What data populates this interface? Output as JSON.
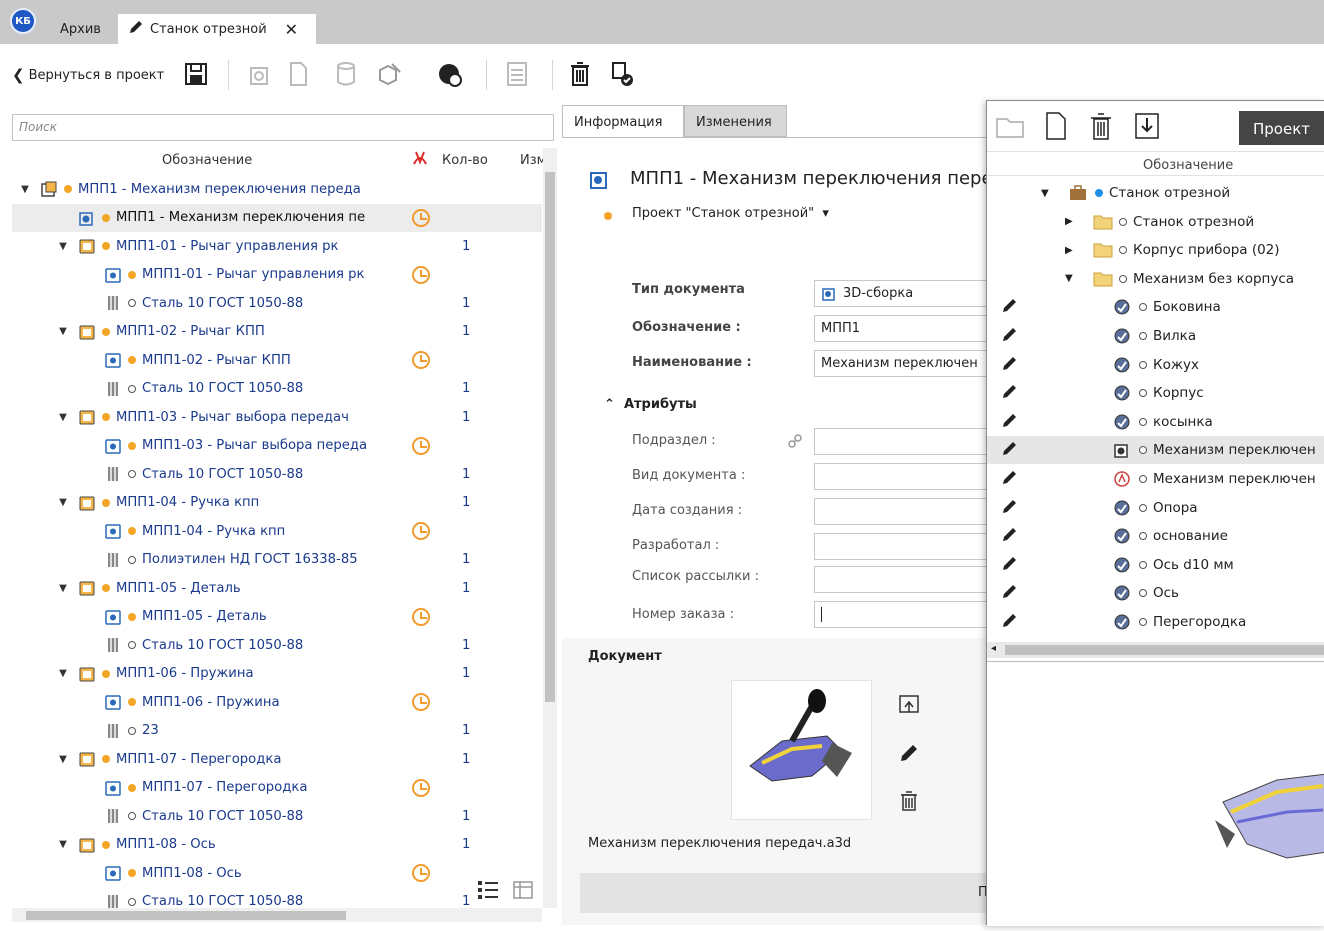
{
  "tabs": {
    "logo": "КБ",
    "archive": "Архив",
    "active": "Станок отрезной",
    "close": "✕"
  },
  "toolbar": {
    "back": "Вернуться в проект"
  },
  "left": {
    "search_placeholder": "Поиск",
    "columns": {
      "designation": "Обозначение",
      "qty": "Кол-во",
      "changes": "Изм"
    },
    "rows": [
      {
        "label": "МПП1 - Механизм переключения переда",
        "qty": "",
        "level": 0,
        "icon": "assembly",
        "dot": "orange",
        "expanded": true,
        "clock": false,
        "sel": false
      },
      {
        "label": "МПП1 - Механизм переключения пе",
        "qty": "",
        "level": 1,
        "icon": "assembly-doc",
        "dot": "orange",
        "expanded": null,
        "clock": true,
        "sel": true
      },
      {
        "label": "МПП1-01 - Рычаг управления рк",
        "qty": "1",
        "level": 1,
        "icon": "part",
        "dot": "orange",
        "expanded": true,
        "clock": false,
        "sel": false
      },
      {
        "label": "МПП1-01 - Рычаг управления рк",
        "qty": "",
        "level": 2,
        "icon": "part-doc",
        "dot": "orange",
        "expanded": null,
        "clock": true,
        "sel": false
      },
      {
        "label": "Сталь 10 ГОСТ 1050-88",
        "qty": "1",
        "level": 2,
        "icon": "material",
        "dot": "hollow",
        "expanded": null,
        "clock": false,
        "sel": false
      },
      {
        "label": "МПП1-02 - Рычаг КПП",
        "qty": "1",
        "level": 1,
        "icon": "part",
        "dot": "orange",
        "expanded": true,
        "clock": false,
        "sel": false
      },
      {
        "label": "МПП1-02 - Рычаг КПП",
        "qty": "",
        "level": 2,
        "icon": "part-doc",
        "dot": "orange",
        "expanded": null,
        "clock": true,
        "sel": false
      },
      {
        "label": "Сталь 10 ГОСТ 1050-88",
        "qty": "1",
        "level": 2,
        "icon": "material",
        "dot": "hollow",
        "expanded": null,
        "clock": false,
        "sel": false
      },
      {
        "label": "МПП1-03 - Рычаг выбора передач",
        "qty": "1",
        "level": 1,
        "icon": "part",
        "dot": "orange",
        "expanded": true,
        "clock": false,
        "sel": false
      },
      {
        "label": "МПП1-03 - Рычаг выбора переда",
        "qty": "",
        "level": 2,
        "icon": "part-doc",
        "dot": "orange",
        "expanded": null,
        "clock": true,
        "sel": false
      },
      {
        "label": "Сталь 10 ГОСТ 1050-88",
        "qty": "1",
        "level": 2,
        "icon": "material",
        "dot": "hollow",
        "expanded": null,
        "clock": false,
        "sel": false
      },
      {
        "label": "МПП1-04 - Ручка кпп",
        "qty": "1",
        "level": 1,
        "icon": "part",
        "dot": "orange",
        "expanded": true,
        "clock": false,
        "sel": false
      },
      {
        "label": "МПП1-04 - Ручка кпп",
        "qty": "",
        "level": 2,
        "icon": "part-doc",
        "dot": "orange",
        "expanded": null,
        "clock": true,
        "sel": false
      },
      {
        "label": "Полиэтилен НД ГОСТ 16338-85",
        "qty": "1",
        "level": 2,
        "icon": "material",
        "dot": "hollow",
        "expanded": null,
        "clock": false,
        "sel": false
      },
      {
        "label": "МПП1-05 - Деталь",
        "qty": "1",
        "level": 1,
        "icon": "part",
        "dot": "orange",
        "expanded": true,
        "clock": false,
        "sel": false
      },
      {
        "label": "МПП1-05 - Деталь",
        "qty": "",
        "level": 2,
        "icon": "part-doc",
        "dot": "orange",
        "expanded": null,
        "clock": true,
        "sel": false
      },
      {
        "label": "Сталь 10 ГОСТ 1050-88",
        "qty": "1",
        "level": 2,
        "icon": "material",
        "dot": "hollow",
        "expanded": null,
        "clock": false,
        "sel": false
      },
      {
        "label": "МПП1-06 - Пружина",
        "qty": "1",
        "level": 1,
        "icon": "part",
        "dot": "orange",
        "expanded": true,
        "clock": false,
        "sel": false
      },
      {
        "label": "МПП1-06 - Пружина",
        "qty": "",
        "level": 2,
        "icon": "part-doc",
        "dot": "orange",
        "expanded": null,
        "clock": true,
        "sel": false
      },
      {
        "label": "23",
        "qty": "1",
        "level": 2,
        "icon": "material",
        "dot": "hollow",
        "expanded": null,
        "clock": false,
        "sel": false
      },
      {
        "label": "МПП1-07 - Перегородка",
        "qty": "1",
        "level": 1,
        "icon": "part",
        "dot": "orange",
        "expanded": true,
        "clock": false,
        "sel": false
      },
      {
        "label": "МПП1-07 - Перегородка",
        "qty": "",
        "level": 2,
        "icon": "part-doc",
        "dot": "orange",
        "expanded": null,
        "clock": true,
        "sel": false
      },
      {
        "label": "Сталь 10 ГОСТ 1050-88",
        "qty": "1",
        "level": 2,
        "icon": "material",
        "dot": "hollow",
        "expanded": null,
        "clock": false,
        "sel": false
      },
      {
        "label": "МПП1-08 - Ось",
        "qty": "1",
        "level": 1,
        "icon": "part",
        "dot": "orange",
        "expanded": true,
        "clock": false,
        "sel": false
      },
      {
        "label": "МПП1-08 - Ось",
        "qty": "",
        "level": 2,
        "icon": "part-doc",
        "dot": "orange",
        "expanded": null,
        "clock": true,
        "sel": false
      },
      {
        "label": "Сталь 10 ГОСТ 1050-88",
        "qty": "1",
        "level": 2,
        "icon": "material",
        "dot": "hollow",
        "expanded": null,
        "clock": false,
        "sel": false
      }
    ]
  },
  "info": {
    "tab_info": "Информация",
    "tab_changes": "Изменения",
    "title": "МПП1 - Механизм переключения пере",
    "project": "Проект \"Станок отрезной\"",
    "doc_type_label": "Тип документа",
    "doc_type_value": "3D-сборка",
    "designation_label": "Обозначение :",
    "designation_value": "МПП1",
    "name_label": "Наименование :",
    "name_value": "Механизм переключен",
    "attributes": "Атрибуты",
    "attr_labels": [
      "Подраздел :",
      "Вид документа :",
      "Дата создания :",
      "Разработал :",
      "Список рассылки :",
      "Номер заказа :"
    ],
    "document_label": "Документ",
    "file_name": "Механизм переключения передач.a3d",
    "bottom_char": "П"
  },
  "popup": {
    "project_button": "Проект",
    "column": "Обозначение",
    "rows": [
      {
        "label": "Станок отрезной",
        "level": 0,
        "icon": "briefcase",
        "dot": "blue",
        "exp": "down",
        "pen": false,
        "sel": false
      },
      {
        "label": "Станок отрезной",
        "level": 1,
        "icon": "folder",
        "dot": "hollow",
        "exp": "right",
        "pen": false,
        "sel": false
      },
      {
        "label": "Корпус прибора (02)",
        "level": 1,
        "icon": "folder",
        "dot": "hollow",
        "exp": "right",
        "pen": false,
        "sel": false
      },
      {
        "label": "Механизм без корпуса",
        "level": 1,
        "icon": "folder",
        "dot": "hollow",
        "exp": "down",
        "pen": false,
        "sel": false
      },
      {
        "label": "Боковина",
        "level": 2,
        "icon": "detail",
        "dot": "hollow",
        "exp": "",
        "pen": true,
        "sel": false
      },
      {
        "label": "Вилка",
        "level": 2,
        "icon": "detail",
        "dot": "hollow",
        "exp": "",
        "pen": true,
        "sel": false
      },
      {
        "label": "Кожух",
        "level": 2,
        "icon": "detail",
        "dot": "hollow",
        "exp": "",
        "pen": true,
        "sel": false
      },
      {
        "label": "Корпус",
        "level": 2,
        "icon": "detail",
        "dot": "hollow",
        "exp": "",
        "pen": true,
        "sel": false
      },
      {
        "label": "косынка",
        "level": 2,
        "icon": "detail",
        "dot": "hollow",
        "exp": "",
        "pen": true,
        "sel": false
      },
      {
        "label": "Механизм переключен",
        "level": 2,
        "icon": "assembly",
        "dot": "hollow",
        "exp": "",
        "pen": true,
        "sel": true
      },
      {
        "label": "Механизм переключен",
        "level": 2,
        "icon": "drawing",
        "dot": "hollow",
        "exp": "",
        "pen": true,
        "sel": false
      },
      {
        "label": "Опора",
        "level": 2,
        "icon": "detail",
        "dot": "hollow",
        "exp": "",
        "pen": true,
        "sel": false
      },
      {
        "label": "основание",
        "level": 2,
        "icon": "detail",
        "dot": "hollow",
        "exp": "",
        "pen": true,
        "sel": false
      },
      {
        "label": "Ось d10 мм",
        "level": 2,
        "icon": "detail",
        "dot": "hollow",
        "exp": "",
        "pen": true,
        "sel": false
      },
      {
        "label": "Ось",
        "level": 2,
        "icon": "detail",
        "dot": "hollow",
        "exp": "",
        "pen": true,
        "sel": false
      },
      {
        "label": "Перегородка",
        "level": 2,
        "icon": "detail",
        "dot": "hollow",
        "exp": "",
        "pen": true,
        "sel": false
      }
    ]
  }
}
